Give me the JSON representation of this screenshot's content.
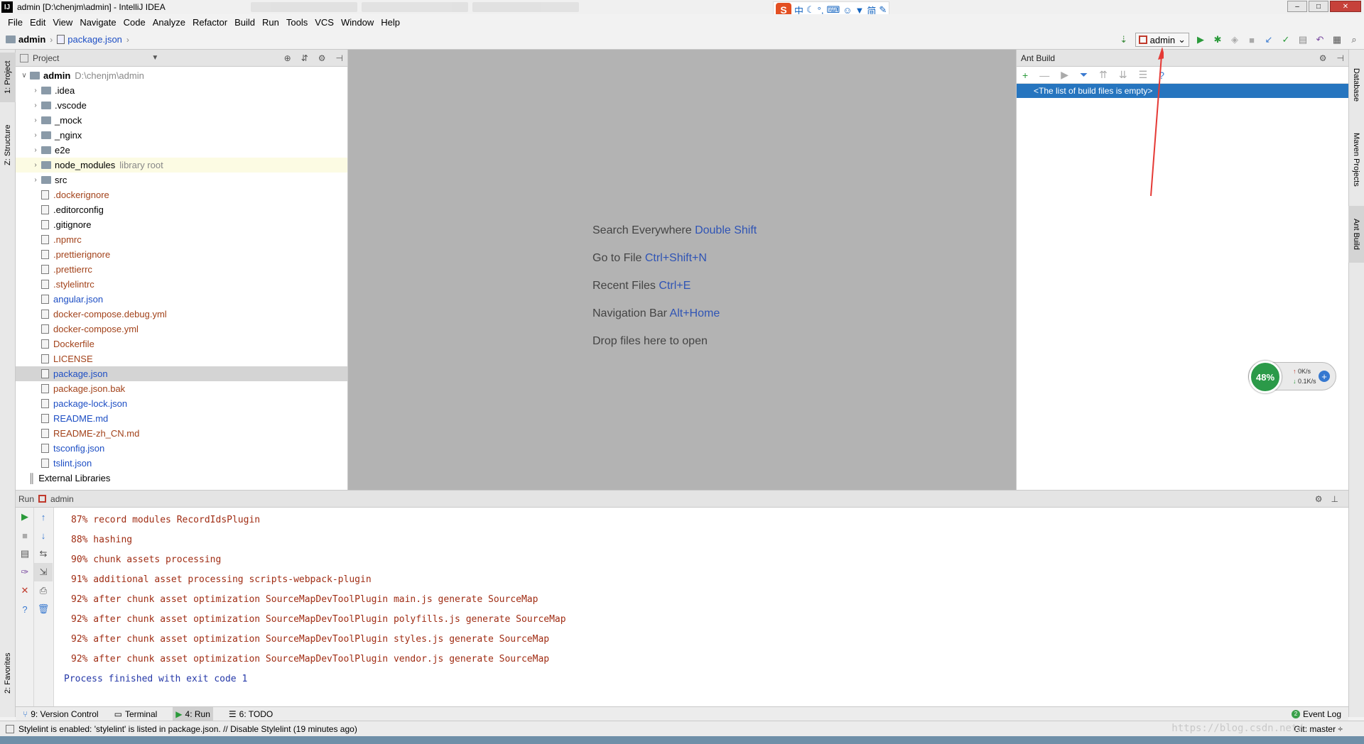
{
  "window": {
    "title": "admin [D:\\chenjm\\admin] - IntelliJ IDEA",
    "app_icon": "IJ",
    "buttons": [
      "–",
      "□",
      "✕"
    ]
  },
  "ime": {
    "logo": "S",
    "mode": "中",
    "simplified": "简"
  },
  "menu": [
    "File",
    "Edit",
    "View",
    "Navigate",
    "Code",
    "Analyze",
    "Refactor",
    "Build",
    "Run",
    "Tools",
    "VCS",
    "Window",
    "Help"
  ],
  "breadcrumb": {
    "project": "admin",
    "file": "package.json"
  },
  "run_toolbar": {
    "config": "admin"
  },
  "left_tabs": {
    "project": "1: Project",
    "structure": "Z: Structure",
    "favorites": "2: Favorites"
  },
  "right_tabs": {
    "database": "Database",
    "maven": "Maven Projects",
    "ant": "Ant Build"
  },
  "project_panel": {
    "title": "Project",
    "root": {
      "name": "admin",
      "path": "D:\\chenjm\\admin"
    },
    "folders": [
      {
        "name": ".idea",
        "note": ""
      },
      {
        "name": ".vscode",
        "note": ""
      },
      {
        "name": "_mock",
        "note": ""
      },
      {
        "name": "_nginx",
        "note": ""
      },
      {
        "name": "e2e",
        "note": ""
      },
      {
        "name": "node_modules",
        "note": "library root"
      },
      {
        "name": "src",
        "note": ""
      }
    ],
    "files": [
      {
        "name": ".dockerignore",
        "color": "brown"
      },
      {
        "name": ".editorconfig",
        "color": "normal"
      },
      {
        "name": ".gitignore",
        "color": "normal"
      },
      {
        "name": ".npmrc",
        "color": "brown"
      },
      {
        "name": ".prettierignore",
        "color": "brown"
      },
      {
        "name": ".prettierrc",
        "color": "brown"
      },
      {
        "name": ".stylelintrc",
        "color": "brown"
      },
      {
        "name": "angular.json",
        "color": "blue"
      },
      {
        "name": "docker-compose.debug.yml",
        "color": "brown"
      },
      {
        "name": "docker-compose.yml",
        "color": "brown"
      },
      {
        "name": "Dockerfile",
        "color": "brown"
      },
      {
        "name": "LICENSE",
        "color": "brown"
      },
      {
        "name": "package.json",
        "color": "blue"
      },
      {
        "name": "package.json.bak",
        "color": "brown"
      },
      {
        "name": "package-lock.json",
        "color": "blue"
      },
      {
        "name": "README.md",
        "color": "blue"
      },
      {
        "name": "README-zh_CN.md",
        "color": "brown"
      },
      {
        "name": "tsconfig.json",
        "color": "blue"
      },
      {
        "name": "tslint.json",
        "color": "blue"
      }
    ],
    "external": "External Libraries"
  },
  "editor_hints": [
    {
      "label": "Search Everywhere",
      "key": "Double Shift"
    },
    {
      "label": "Go to File",
      "key": "Ctrl+Shift+N"
    },
    {
      "label": "Recent Files",
      "key": "Ctrl+E"
    },
    {
      "label": "Navigation Bar",
      "key": "Alt+Home"
    },
    {
      "label": "Drop files here to open",
      "key": ""
    }
  ],
  "ant_panel": {
    "title": "Ant Build",
    "empty": "<The list of build files is empty>"
  },
  "net_widget": {
    "percent": "48%",
    "up": "0K/s",
    "down": "0.1K/s"
  },
  "run_panel": {
    "label": "Run",
    "config": "admin",
    "log": [
      "87% record modules RecordIdsPlugin",
      "88% hashing",
      "90% chunk assets processing",
      "91% additional asset processing scripts-webpack-plugin",
      "92% after chunk asset optimization SourceMapDevToolPlugin main.js generate SourceMap",
      "92% after chunk asset optimization SourceMapDevToolPlugin polyfills.js generate SourceMap",
      "92% after chunk asset optimization SourceMapDevToolPlugin styles.js generate SourceMap",
      "92% after chunk asset optimization SourceMapDevToolPlugin vendor.js generate SourceMap"
    ],
    "exit": "Process finished with exit code 1"
  },
  "bottom_tabs": [
    "9: Version Control",
    "Terminal",
    "4: Run",
    "6: TODO"
  ],
  "event_log": {
    "label": "Event Log",
    "count": "2"
  },
  "status": {
    "message": "Stylelint is enabled: 'stylelint' is listed in package.json. // Disable Stylelint (19 minutes ago)",
    "git": "Git: master ÷"
  },
  "watermark": "https://blog.csdn.net/..."
}
